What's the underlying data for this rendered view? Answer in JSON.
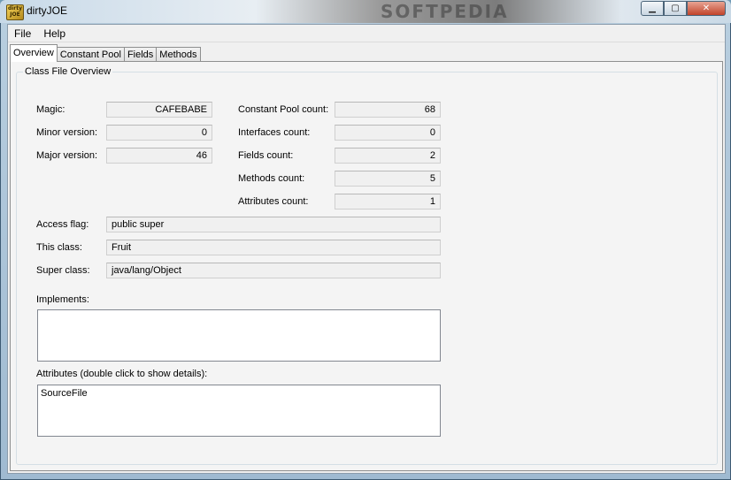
{
  "window": {
    "title": "dirtyJOE",
    "icon_text": "dirty JOE",
    "watermark": "SOFTPEDIA"
  },
  "menu": {
    "items": [
      "File",
      "Help"
    ]
  },
  "tabs": [
    "Overview",
    "Constant Pool",
    "Fields",
    "Methods"
  ],
  "active_tab": "Overview",
  "group_title": "Class File Overview",
  "labels": {
    "magic": "Magic:",
    "minor_version": "Minor version:",
    "major_version": "Major version:",
    "constant_pool_count": "Constant Pool count:",
    "interfaces_count": "Interfaces count:",
    "fields_count": "Fields count:",
    "methods_count": "Methods count:",
    "attributes_count": "Attributes count:",
    "access_flag": "Access flag:",
    "this_class": "This class:",
    "super_class": "Super class:",
    "implements": "Implements:",
    "attributes": "Attributes (double click to show details):"
  },
  "values": {
    "magic": "CAFEBABE",
    "minor_version": "0",
    "major_version": "46",
    "constant_pool_count": "68",
    "interfaces_count": "0",
    "fields_count": "2",
    "methods_count": "5",
    "attributes_count": "1",
    "access_flag": "public super",
    "this_class": "Fruit",
    "super_class": "java/lang/Object"
  },
  "implements_list": [],
  "attributes_list": [
    "SourceFile"
  ]
}
